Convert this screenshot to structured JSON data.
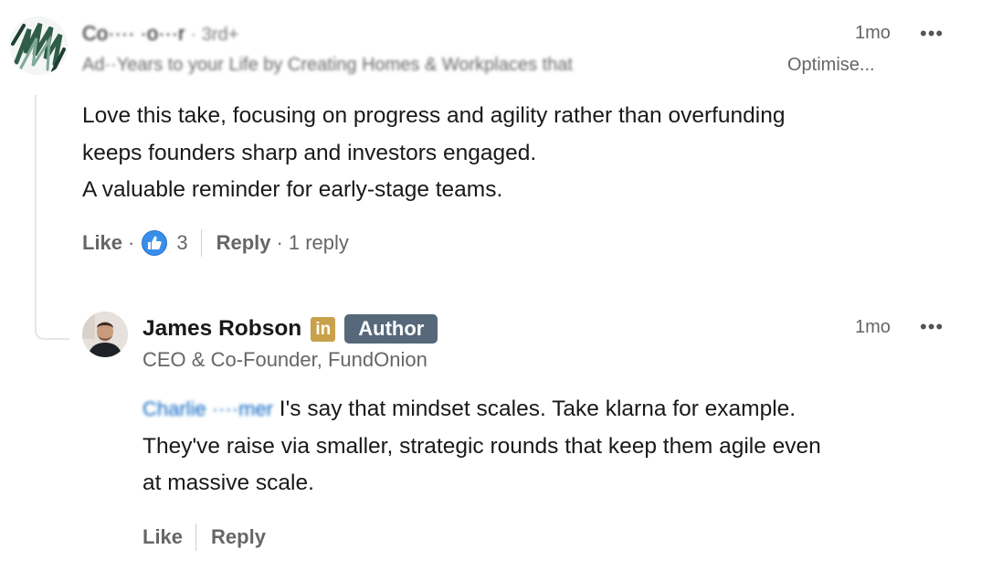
{
  "top_comment": {
    "author_name": "Co···· ·o···r",
    "degree": "· 3rd+",
    "headline": "Ad··Years to your Life by Creating Homes & Workplaces that",
    "headline_tail": "Optimise...",
    "time": "1mo",
    "more": "•••",
    "text_lines": [
      "Love this take, focusing on progress and agility rather than overfunding",
      "keeps founders sharp and investors engaged.",
      "A valuable reminder for early-stage teams."
    ],
    "like_label": "Like",
    "reaction_count": "3",
    "reply_label": "Reply",
    "reply_count": "1 reply"
  },
  "reply_comment": {
    "author_name": "James Robson",
    "linkedin_badge": "in",
    "author_badge": "Author",
    "headline": "CEO & Co-Founder, FundOnion",
    "time": "1mo",
    "more": "•••",
    "mention": "Charlie ····mer",
    "text_first": " I's say that mindset scales. Take klarna for example.",
    "text_lines": [
      "They've raise via smaller, strategic rounds that keep them agile even",
      "at massive scale."
    ],
    "like_label": "Like",
    "reply_label": "Reply"
  },
  "colors": {
    "reaction_blue": "#378fe9",
    "author_badge_bg": "#56687a",
    "linkedin_gold": "#c8a14a",
    "mention_blue": "#0a66c2",
    "thread_line": "#e8e6e1"
  },
  "icons": [
    "abstract-avatar-icon",
    "more-options-icon",
    "like-reaction-icon",
    "linkedin-icon",
    "profile-photo-icon"
  ]
}
